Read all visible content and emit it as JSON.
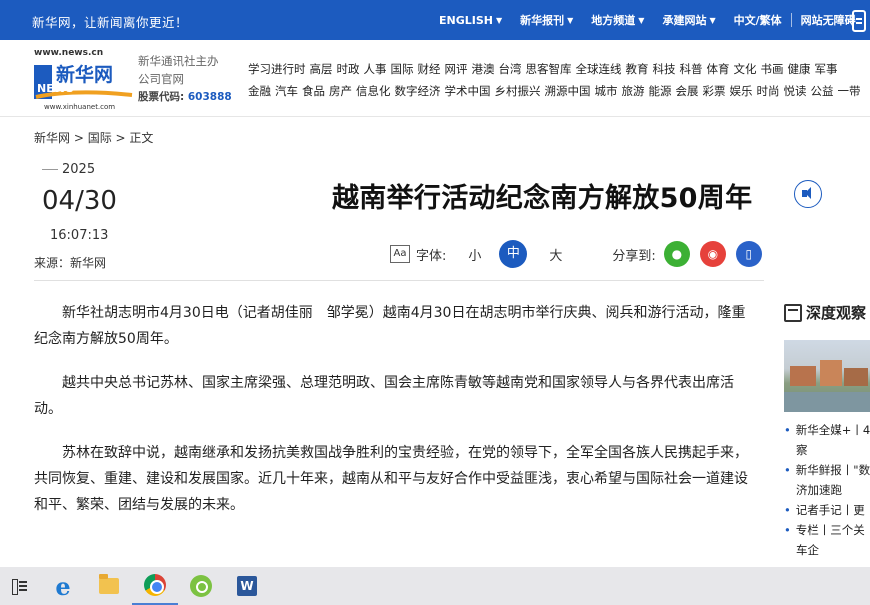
{
  "topbar": {
    "slogan": "新华网，让新闻离你更近！",
    "nav": [
      {
        "label": "ENGLISH",
        "chevron": true
      },
      {
        "label": "新华报刊",
        "chevron": true
      },
      {
        "label": "地方频道",
        "chevron": true
      },
      {
        "label": "承建网站",
        "chevron": true
      },
      {
        "label": "中文/繁体",
        "chevron": false
      },
      {
        "label": "网站无障碍",
        "chevron": false
      }
    ],
    "color": "#1c5bbf"
  },
  "logo": {
    "url_top": "www.news.cn",
    "brand_cn": "新华网",
    "brand_en": "NEWS",
    "url_bottom": "www.xinhuanet.com"
  },
  "company": {
    "line1": "新华通讯社主办",
    "line2": "公司官网",
    "stock_label": "股票代码:",
    "stock_code": "603888"
  },
  "channels": {
    "row1": [
      "学习进行时",
      "高层",
      "时政",
      "人事",
      "国际",
      "财经",
      "网评",
      "港澳",
      "台湾",
      "思客智库",
      "全球连线",
      "教育",
      "科技",
      "科普",
      "体育",
      "文化",
      "书画",
      "健康",
      "军事"
    ],
    "row2": [
      "金融",
      "汽车",
      "食品",
      "房产",
      "信息化",
      "数字经济",
      "学术中国",
      "乡村振兴",
      "溯源中国",
      "城市",
      "旅游",
      "能源",
      "会展",
      "彩票",
      "娱乐",
      "时尚",
      "悦读",
      "公益",
      "一带"
    ]
  },
  "breadcrumb": [
    "新华网",
    "国际",
    "正文"
  ],
  "article": {
    "year": "2025",
    "monthday": "04/30",
    "time": "16:07:13",
    "source": "来源：新华网",
    "title": "越南举行活动纪念南方解放50周年",
    "paragraphs": [
      "新华社胡志明市4月30日电（记者胡佳丽　邹学冕）越南4月30日在胡志明市举行庆典、阅兵和游行活动，隆重纪念南方解放50周年。",
      "越共中央总书记苏林、国家主席梁强、总理范明政、国会主席陈青敏等越南党和国家领导人与各界代表出席活动。",
      "苏林在致辞中说，越南继承和发扬抗美救国战争胜利的宝贵经验，在党的领导下，全军全国各族人民携起手来，共同恢复、重建、建设和发展国家。近几十年来，越南从和平与友好合作中受益匪浅，衷心希望与国际社会一道建设和平、繁荣、团结与发展的未来。"
    ]
  },
  "tools": {
    "font_label": "字体:",
    "sizes": [
      "小",
      "中",
      "大"
    ],
    "share_label": "分享到:"
  },
  "sidebar": {
    "heading": "深度观察",
    "items": [
      {
        "text": "新华全媒+丨4",
        "cont": "察"
      },
      {
        "text": "新华鲜报丨\"数",
        "cont": "济加速跑"
      },
      {
        "text": "记者手记丨更",
        "cont": ""
      },
      {
        "text": "专栏丨三个关",
        "cont": "车企"
      }
    ]
  },
  "taskbar": {
    "apps": [
      "task-view",
      "edge",
      "file-explorer",
      "chrome",
      "green-app",
      "word"
    ]
  }
}
